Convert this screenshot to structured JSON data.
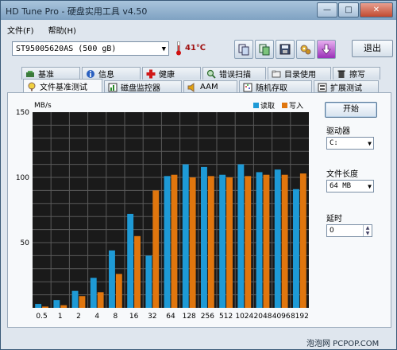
{
  "window": {
    "title": "HD Tune Pro - 硬盘实用工具 v4.50"
  },
  "menu": [
    {
      "label": "文件(F)"
    },
    {
      "label": "帮助(H)"
    }
  ],
  "drive": {
    "selected": "ST95005620AS (500 gB)",
    "temperature": "41℃"
  },
  "toolbar": {
    "exit_label": "退出"
  },
  "tabs_top": [
    {
      "label": "基准",
      "icon": "benchmark-icon"
    },
    {
      "label": "信息",
      "icon": "info-icon"
    },
    {
      "label": "健康",
      "icon": "health-cross-icon"
    },
    {
      "label": "错误扫描",
      "icon": "magnifier-icon"
    },
    {
      "label": "目录使用",
      "icon": "folder-icon"
    },
    {
      "label": "擦写",
      "icon": "trash-icon"
    }
  ],
  "tabs_bottom": [
    {
      "label": "文件基准测试",
      "icon": "file-benchmark-icon",
      "active": true
    },
    {
      "label": "磁盘监控器",
      "icon": "monitor-chart-icon",
      "active": false
    },
    {
      "label": "AAM",
      "icon": "speaker-icon",
      "active": false
    },
    {
      "label": "随机存取",
      "icon": "random-access-icon",
      "active": false
    },
    {
      "label": "扩展测试",
      "icon": "extra-test-icon",
      "active": false
    }
  ],
  "side": {
    "start_label": "开始",
    "drive_label": "驱动器",
    "drive_value": "C:",
    "length_label": "文件长度",
    "length_value": "64 MB",
    "delay_label": "延时",
    "delay_value": "0"
  },
  "watermark": "泡泡网 PCPOP.COM",
  "colors": {
    "read": "#1e9ad6",
    "write": "#e0760e",
    "chart_bg": "#1a1a1a",
    "grid": "#5a5a5a"
  },
  "chart_data": {
    "type": "bar",
    "ylabel": "MB/s",
    "ylim": [
      0,
      150
    ],
    "yticks": [
      50,
      100,
      150
    ],
    "categories": [
      "0.5",
      "1",
      "2",
      "4",
      "8",
      "16",
      "32",
      "64",
      "128",
      "256",
      "512",
      "1024",
      "2048",
      "4096",
      "8192"
    ],
    "series": [
      {
        "name": "读取",
        "values": [
          3,
          6,
          13,
          23,
          44,
          72,
          40,
          101,
          110,
          108,
          102,
          110,
          104,
          106,
          91
        ]
      },
      {
        "name": "写入",
        "values": [
          1,
          2,
          9,
          12,
          26,
          55,
          90,
          102,
          100,
          101,
          100,
          101,
          102,
          102,
          103
        ]
      }
    ],
    "legend": "top-right",
    "grid": true
  }
}
